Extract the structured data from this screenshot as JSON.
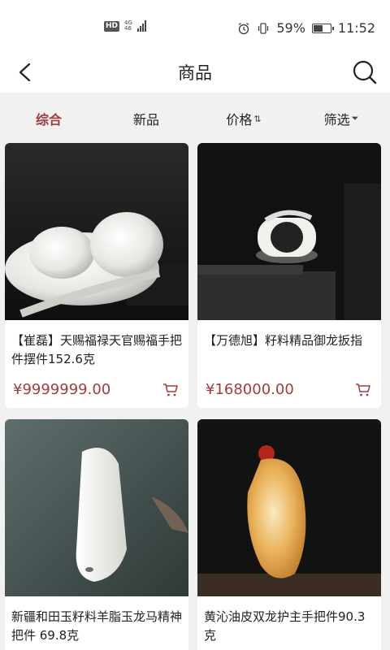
{
  "status_bar": {
    "hd": "HD",
    "net_top": "4G",
    "net_bottom": "46",
    "battery_pct": "59%",
    "battery_level": 0.59,
    "time": "11:52"
  },
  "header": {
    "title": "商品"
  },
  "tabs": [
    {
      "label": "综合",
      "icon": ""
    },
    {
      "label": "新品",
      "icon": ""
    },
    {
      "label": "价格",
      "icon": "⇅"
    },
    {
      "label": "筛选",
      "icon": "⏷"
    }
  ],
  "products": [
    {
      "title": "【崔磊】天赐福禄天官赐福手把件摆件152.6克",
      "price": "¥9999999.00"
    },
    {
      "title": "【万德旭】籽料精品御龙扳指",
      "price": "¥168000.00"
    },
    {
      "title": "新疆和田玉籽料羊脂玉龙马精神把件 69.8克",
      "price": ""
    },
    {
      "title": "黄沁油皮双龙护主手把件90.3克",
      "price": ""
    }
  ],
  "colors": {
    "accent": "#a23b3b",
    "background": "#f1f1f1"
  }
}
